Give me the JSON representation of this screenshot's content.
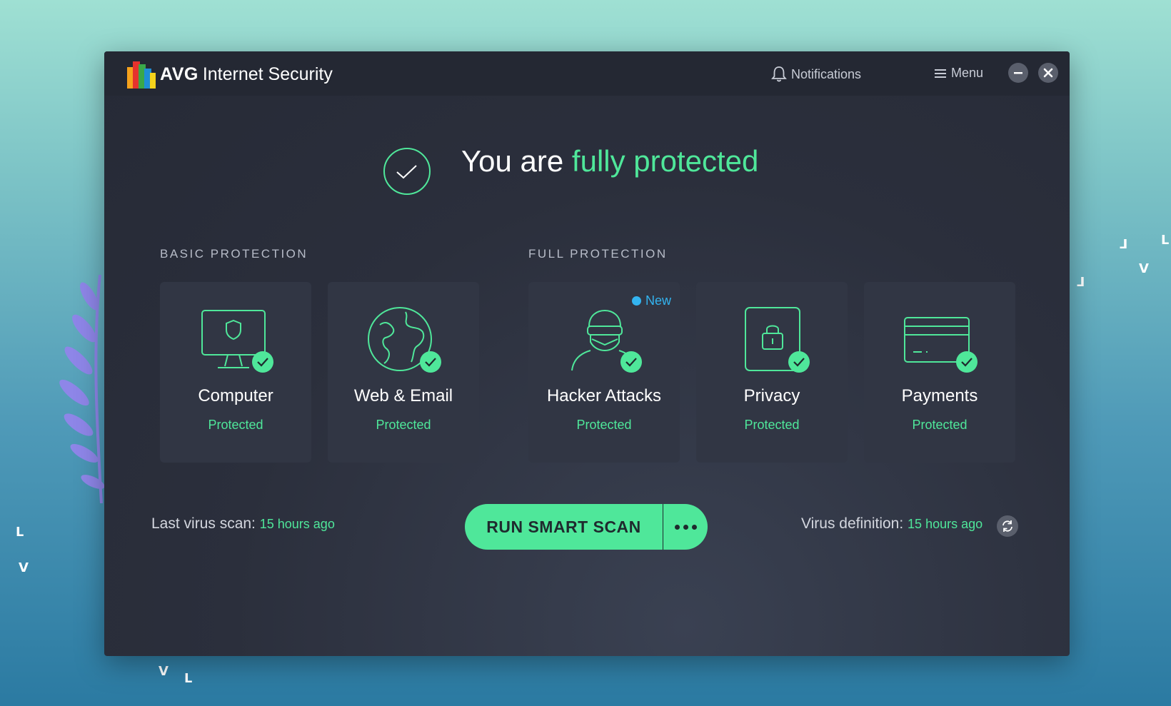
{
  "app": {
    "brand": "AVG",
    "name": "Internet Security"
  },
  "titlebar": {
    "notifications_label": "Notifications",
    "menu_label": "Menu"
  },
  "status": {
    "prefix": "You are",
    "highlight": "fully protected"
  },
  "sections": {
    "basic": "BASIC PROTECTION",
    "full": "FULL PROTECTION"
  },
  "cards": [
    {
      "name": "Computer",
      "state": "Protected",
      "icon": "monitor-shield-icon"
    },
    {
      "name": "Web & Email",
      "state": "Protected",
      "icon": "globe-icon"
    },
    {
      "name": "Hacker Attacks",
      "state": "Protected",
      "icon": "hacker-icon",
      "badge": "New"
    },
    {
      "name": "Privacy",
      "state": "Protected",
      "icon": "lock-phone-icon"
    },
    {
      "name": "Payments",
      "state": "Protected",
      "icon": "credit-card-icon"
    }
  ],
  "footer": {
    "last_scan_label": "Last virus scan:",
    "last_scan_value": "15 hours ago",
    "scan_button": "RUN SMART SCAN",
    "virus_def_label": "Virus definition:",
    "virus_def_value": "15 hours ago"
  },
  "colors": {
    "accent": "#4fe79a",
    "new_badge": "#33b4f0",
    "window_bg": "#2b2f3c"
  }
}
